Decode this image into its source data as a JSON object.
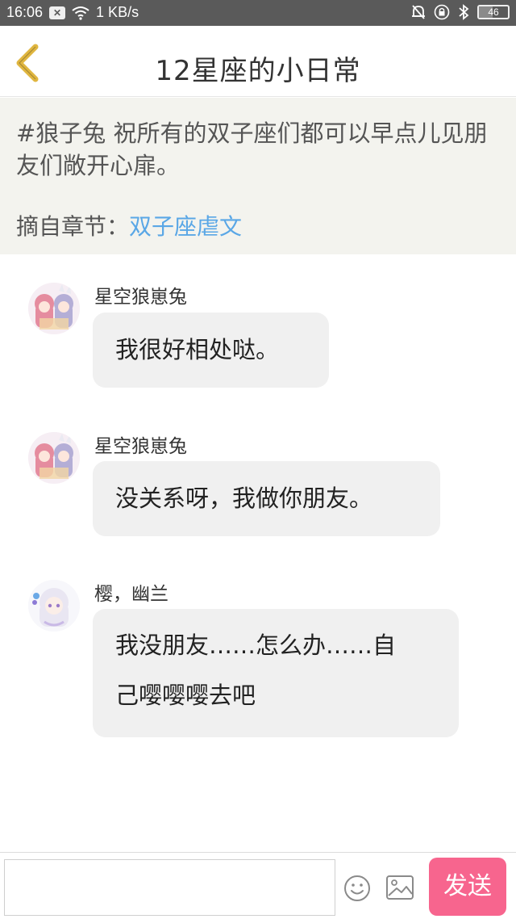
{
  "status_bar": {
    "time": "16:06",
    "network_speed": "1 KB/s",
    "battery": "46",
    "battery_level": 0.46,
    "icons": [
      "x-badge-icon",
      "wifi-icon",
      "mute-bell-icon",
      "lock-rotation-icon",
      "bluetooth-icon",
      "battery-icon"
    ]
  },
  "header": {
    "title": "12星座的小日常",
    "back_icon": "chevron-left-icon",
    "accent_color": "#e0b640"
  },
  "quote": {
    "text": "#狼子兔 祝所有的双子座们都可以早点儿见朋友们敞开心扉。",
    "source_label": "摘自章节：",
    "chapter": "双子座虐文",
    "link_color": "#5aa7e6"
  },
  "messages": [
    {
      "author": "星空狼崽兔",
      "lines": [
        "我很好相处哒。"
      ]
    },
    {
      "author": "星空狼崽兔",
      "lines": [
        "没关系呀，我做你朋友。"
      ]
    },
    {
      "author": "樱，幽兰",
      "lines": [
        "我没朋友……怎么办……自",
        "己嘤嘤嘤去吧"
      ]
    }
  ],
  "input_bar": {
    "input_value": "",
    "emoji_icon": "smiley-icon",
    "image_icon": "image-icon",
    "send_label": "发送",
    "send_color": "#f7658e"
  }
}
